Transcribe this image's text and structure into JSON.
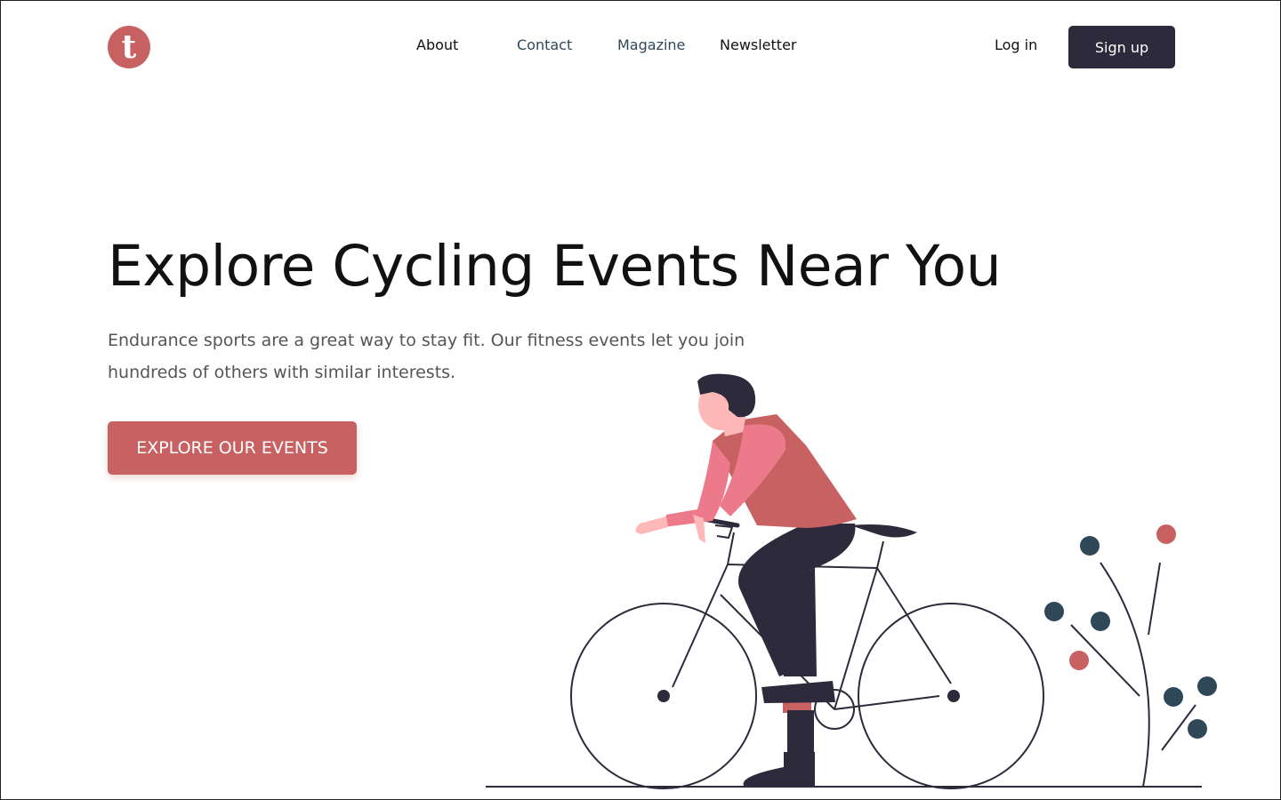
{
  "brand": {
    "logo_letter": "t",
    "color": "#c86262"
  },
  "nav": {
    "links": [
      {
        "label": "About"
      },
      {
        "label": "Contact"
      },
      {
        "label": "Magazine"
      },
      {
        "label": "Newsletter"
      }
    ],
    "login_label": "Log in",
    "signup_label": "Sign up"
  },
  "hero": {
    "title": "Explore Cycling Events Near You",
    "subtitle": "Endurance sports are a great way to stay fit. Our fitness events let you join hundreds of others with similar interests.",
    "cta_label": "EXPLORE OUR EVENTS"
  },
  "colors": {
    "accent": "#c86262",
    "dark": "#2d2b3b",
    "teal": "#2f4858",
    "skin": "#ffb8b8",
    "sleeve": "#ec7a8a"
  }
}
